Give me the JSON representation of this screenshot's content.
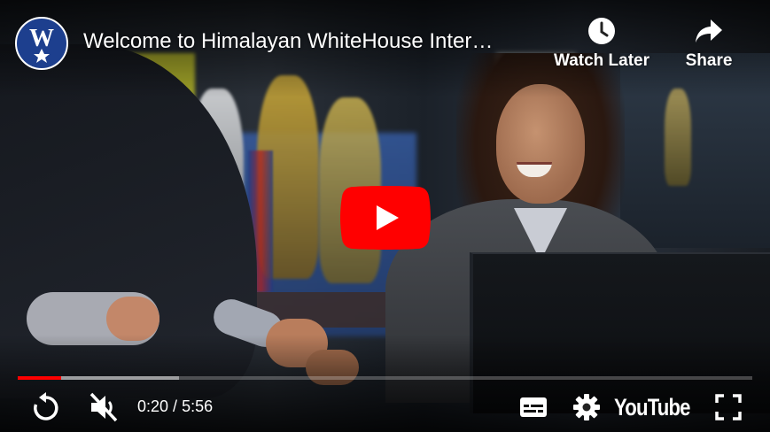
{
  "video": {
    "title": "Welcome to Himalayan WhiteHouse Inter…",
    "channel_logo_letter": "W",
    "progress_fraction": 0.0595,
    "buffered_fraction": 0.22
  },
  "top_actions": {
    "watch_later_label": "Watch Later",
    "share_label": "Share"
  },
  "controls": {
    "current_time": "0:20",
    "duration": "5:56",
    "time_separator": " / ",
    "youtube_label": "YouTube"
  },
  "colors": {
    "progress_played": "#ff0000",
    "play_button": "#ff0000",
    "channel_logo_bg": "#1d3f8e"
  },
  "icons": {
    "replay": "replay-icon",
    "mute": "volume-muted-icon",
    "subtitles": "subtitles-icon",
    "settings": "gear-icon",
    "fullscreen": "fullscreen-icon",
    "watch_later": "clock-icon",
    "share": "share-arrow-icon",
    "play": "play-icon"
  }
}
